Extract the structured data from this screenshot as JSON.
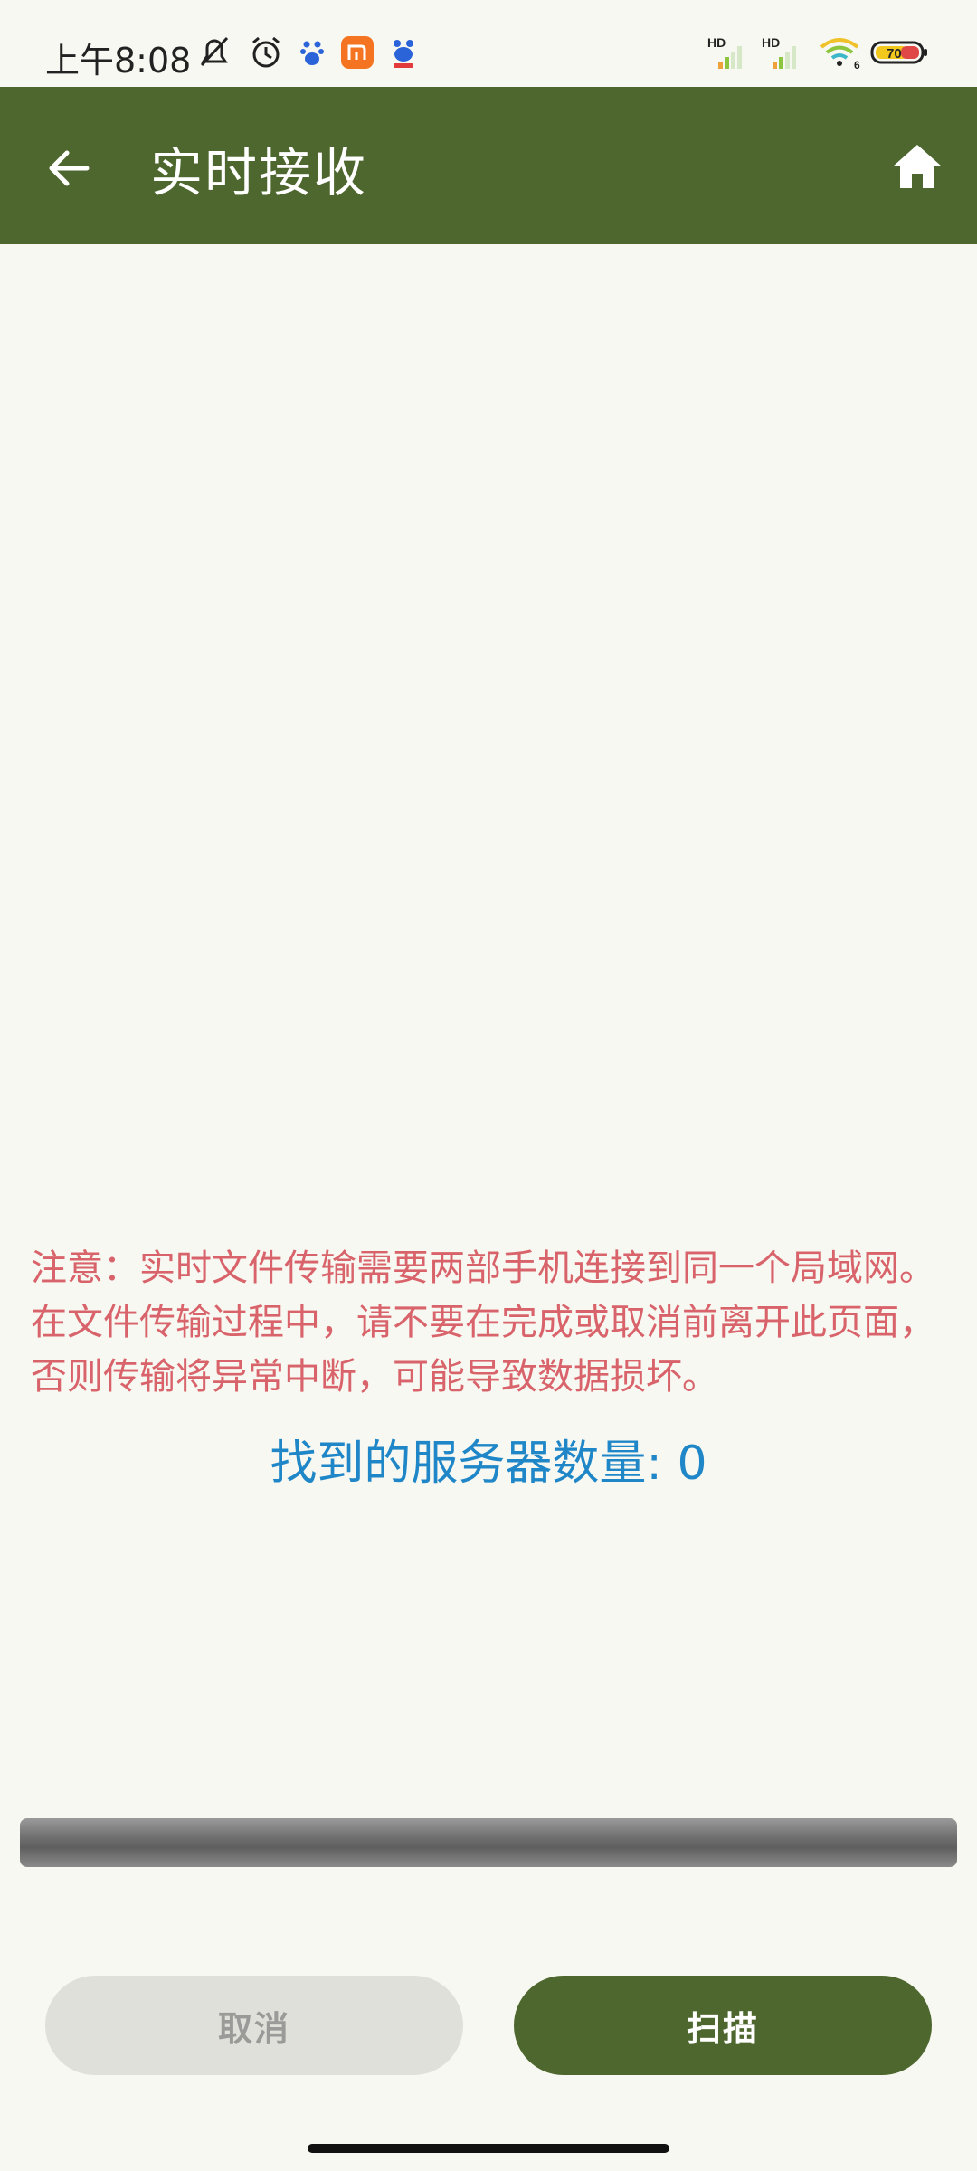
{
  "status_bar": {
    "time": "上午8:08",
    "signal1_label": "HD",
    "signal2_label": "HD",
    "wifi_label": "6",
    "battery_level": "70",
    "icons": [
      "mute-icon",
      "alarm-icon",
      "baidu-icon",
      "mi-icon",
      "baidu-app-icon",
      "signal-icon",
      "wifi-icon",
      "battery-icon"
    ]
  },
  "app_bar": {
    "title": "实时接收",
    "background_color": "#4e672e"
  },
  "main": {
    "notice": "注意：实时文件传输需要两部手机连接到同一个局域网。在文件传输过程中，请不要在完成或取消前离开此页面，否则传输将异常中断，可能导致数据损坏。",
    "server_count_label": "找到的服务器数量: 0"
  },
  "buttons": {
    "cancel_label": "取消",
    "scan_label": "扫描"
  },
  "colors": {
    "accent": "#4e672e",
    "notice": "#d9636b",
    "count": "#1f86c8",
    "background": "#f7f8f1"
  }
}
